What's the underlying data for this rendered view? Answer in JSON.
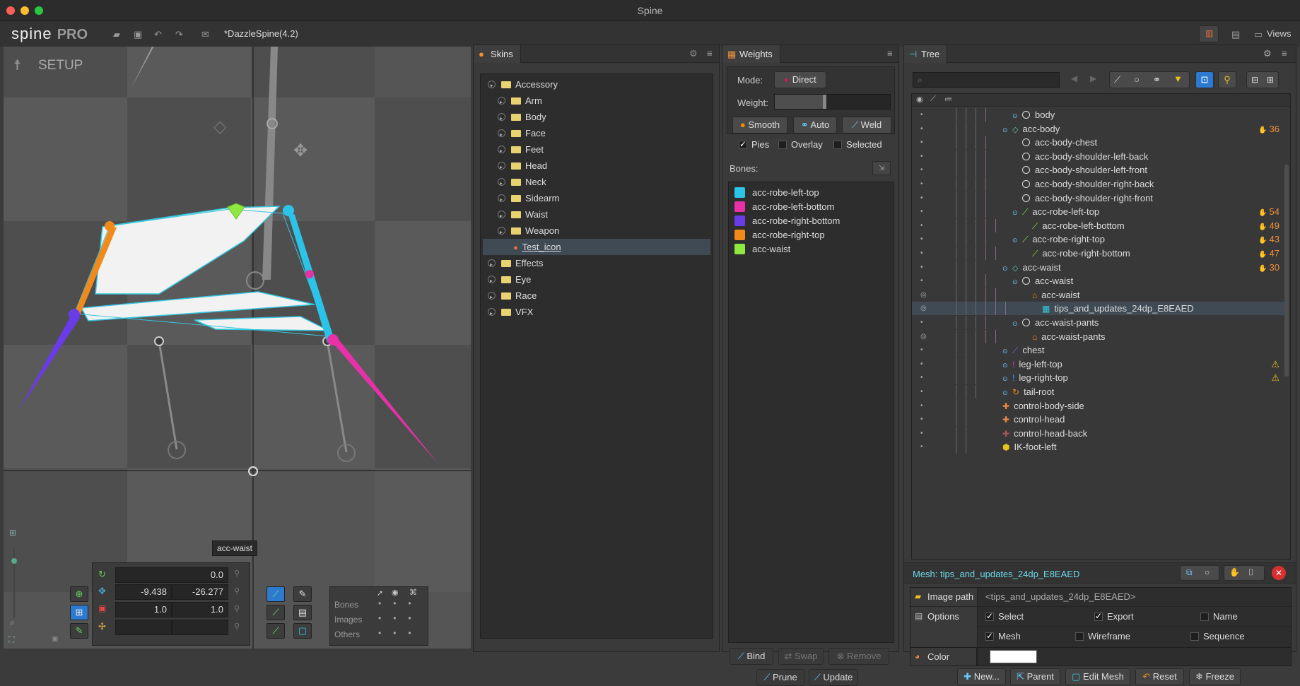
{
  "app": {
    "title": "Spine",
    "project": "*DazzleSpine(4.2)",
    "logo": "spine",
    "edition": "PRO",
    "views_label": "Views"
  },
  "viewport": {
    "mode_label": "SETUP",
    "tooltip": "acc-waist"
  },
  "transform": {
    "rotate": "0.0",
    "translate_x": "-9.438",
    "translate_y": "-26.277",
    "scale_x": "1.0",
    "scale_y": "1.0"
  },
  "visibility": {
    "bones": "Bones",
    "images": "Images",
    "others": "Others"
  },
  "skins": {
    "title": "Skins",
    "items": [
      {
        "label": "Accessory",
        "level": 0,
        "open": true
      },
      {
        "label": "Arm",
        "level": 1
      },
      {
        "label": "Body",
        "level": 1
      },
      {
        "label": "Face",
        "level": 1
      },
      {
        "label": "Feet",
        "level": 1
      },
      {
        "label": "Head",
        "level": 1
      },
      {
        "label": "Neck",
        "level": 1
      },
      {
        "label": "Sidearm",
        "level": 1
      },
      {
        "label": "Waist",
        "level": 1
      },
      {
        "label": "Weapon",
        "level": 1
      },
      {
        "label": "Test_icon",
        "level": 1,
        "selected": true,
        "skin": true
      },
      {
        "label": "Effects",
        "level": 0
      },
      {
        "label": "Eye",
        "level": 0
      },
      {
        "label": "Race",
        "level": 0
      },
      {
        "label": "VFX",
        "level": 0
      }
    ]
  },
  "weights": {
    "title": "Weights",
    "mode_label": "Mode:",
    "mode_value": "Direct",
    "weight_label": "Weight:",
    "smooth": "Smooth",
    "auto": "Auto",
    "weld": "Weld",
    "pies": "Pies",
    "overlay": "Overlay",
    "selected": "Selected",
    "bones_label": "Bones:",
    "bones": [
      {
        "name": "acc-robe-left-top",
        "color": "#2bc4e8"
      },
      {
        "name": "acc-robe-left-bottom",
        "color": "#e830a8"
      },
      {
        "name": "acc-robe-right-bottom",
        "color": "#6a3be8"
      },
      {
        "name": "acc-robe-right-top",
        "color": "#f08a1a"
      },
      {
        "name": "acc-waist",
        "color": "#8ee840"
      }
    ],
    "bind": "Bind",
    "swap": "Swap",
    "remove": "Remove",
    "prune": "Prune",
    "update": "Update"
  },
  "tree": {
    "title": "Tree",
    "rows": [
      {
        "label": "body",
        "indent": 3,
        "icon": "bone"
      },
      {
        "label": "acc-body",
        "indent": 2,
        "icon": "gem",
        "count": "36"
      },
      {
        "label": "acc-body-chest",
        "indent": 3,
        "icon": "bone"
      },
      {
        "label": "acc-body-shoulder-left-back",
        "indent": 3,
        "icon": "bone"
      },
      {
        "label": "acc-body-shoulder-left-front",
        "indent": 3,
        "icon": "bone"
      },
      {
        "label": "acc-body-shoulder-right-back",
        "indent": 3,
        "icon": "bone"
      },
      {
        "label": "acc-body-shoulder-right-front",
        "indent": 3,
        "icon": "bone"
      },
      {
        "label": "acc-robe-left-top",
        "indent": 3,
        "icon": "bonepen",
        "count": "54"
      },
      {
        "label": "acc-robe-left-bottom",
        "indent": 4,
        "icon": "bonepen",
        "count": "49"
      },
      {
        "label": "acc-robe-right-top",
        "indent": 3,
        "icon": "bonepen",
        "count": "43"
      },
      {
        "label": "acc-robe-right-bottom",
        "indent": 4,
        "icon": "bonepen",
        "count": "47"
      },
      {
        "label": "acc-waist",
        "indent": 2,
        "icon": "gem",
        "count": "30"
      },
      {
        "label": "acc-waist",
        "indent": 3,
        "icon": "bone"
      },
      {
        "label": "acc-waist",
        "indent": 4,
        "icon": "slot"
      },
      {
        "label": "tips_and_updates_24dp_E8EAED",
        "indent": 5,
        "icon": "mesh",
        "selected": true
      },
      {
        "label": "acc-waist-pants",
        "indent": 3,
        "icon": "bone"
      },
      {
        "label": "acc-waist-pants",
        "indent": 4,
        "icon": "slot"
      },
      {
        "label": "chest",
        "indent": 2,
        "icon": "bonepurple"
      },
      {
        "label": "leg-left-top",
        "indent": 2,
        "icon": "bonered",
        "warn": true
      },
      {
        "label": "leg-right-top",
        "indent": 2,
        "icon": "boneblue",
        "warn": true
      },
      {
        "label": "tail-root",
        "indent": 2,
        "icon": "spiral"
      },
      {
        "label": "control-body-side",
        "indent": 1,
        "icon": "cross"
      },
      {
        "label": "control-head",
        "indent": 1,
        "icon": "cross"
      },
      {
        "label": "control-head-back",
        "indent": 1,
        "icon": "crossdim"
      },
      {
        "label": "IK-foot-left",
        "indent": 1,
        "icon": "ik"
      }
    ]
  },
  "properties": {
    "title": "Mesh: tips_and_updates_24dp_E8EAED",
    "image_path_label": "Image path",
    "image_path_value": "<tips_and_updates_24dp_E8EAED>",
    "options_label": "Options",
    "select": "Select",
    "export": "Export",
    "name": "Name",
    "mesh": "Mesh",
    "wireframe": "Wireframe",
    "sequence": "Sequence",
    "color_label": "Color",
    "new": "New...",
    "parent": "Parent",
    "edit_mesh": "Edit Mesh",
    "reset": "Reset",
    "freeze": "Freeze"
  }
}
